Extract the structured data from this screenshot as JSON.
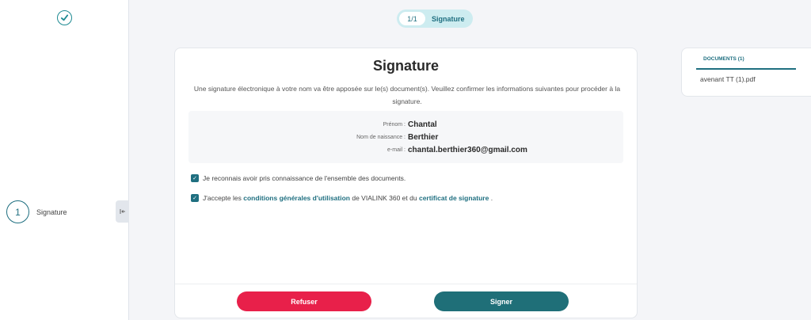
{
  "sidebar": {
    "logo_icon": "check-circle-icon",
    "step": {
      "number": "1",
      "label": "Signature"
    },
    "collapse_icon": "collapse-left-icon"
  },
  "progress": {
    "count": "1/1",
    "title": "Signature"
  },
  "card": {
    "title": "Signature",
    "description": "Une signature électronique à votre nom va être apposée sur le(s) document(s). Veuillez confirmer les informations suivantes pour procéder à la signature.",
    "info": {
      "first_name_label": "Prénom :",
      "first_name": "Chantal",
      "birth_name_label": "Nom de naissance :",
      "birth_name": "Berthier",
      "email_label": "e-mail :",
      "email": "chantal.berthier360@gmail.com"
    },
    "checks": {
      "documents_text": "Je reconnais avoir pris connaissance de l'ensemble des documents.",
      "terms_prefix": "J'accepte les",
      "terms_link": "conditions générales d'utilisation",
      "terms_middle": "de VIALINK 360 et du",
      "certificate_link": "certificat de signature",
      "terms_suffix": "."
    },
    "buttons": {
      "refuse": "Refuser",
      "sign": "Signer"
    }
  },
  "documents": {
    "header": "DOCUMENTS (1)",
    "items": [
      "avenant TT (1).pdf"
    ]
  },
  "colors": {
    "accent": "#1f6f80",
    "refuse": "#e8204a",
    "sign": "#1f6f78",
    "pill": "#cdecf0"
  }
}
